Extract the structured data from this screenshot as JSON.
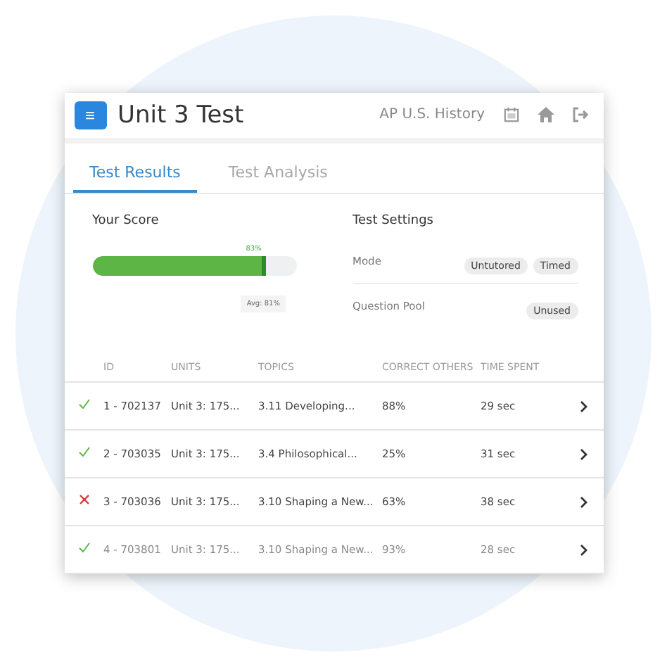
{
  "header": {
    "menu_icon": "≡",
    "title": "Unit 3 Test",
    "course": "AP U.S. History"
  },
  "tabs": [
    {
      "label": "Test Results",
      "selected": true
    },
    {
      "label": "Test Analysis",
      "selected": false
    }
  ],
  "score": {
    "title": "Your Score",
    "level": 0.83,
    "value_label": "83%",
    "average_label": "Avg: 81%"
  },
  "settings": {
    "title": "Test Settings",
    "rows": [
      {
        "label": "Mode",
        "tags": [
          "Untutored",
          "Timed"
        ]
      },
      {
        "label": "Question Pool",
        "tags": [
          "Unused"
        ]
      }
    ]
  },
  "table": {
    "columns": [
      "ID",
      "UNITS",
      "TOPICS",
      "CORRECT OTHERS",
      "TIME SPENT"
    ],
    "rows": [
      {
        "correct": true,
        "faded": false,
        "cells": [
          "1 - 702137",
          "Unit 3: 175...",
          "3.11 Developing...",
          "88%",
          "29 sec"
        ]
      },
      {
        "correct": true,
        "faded": false,
        "cells": [
          "2 - 703035",
          "Unit 3: 175...",
          "3.4 Philosophical...",
          "25%",
          "31 sec"
        ]
      },
      {
        "correct": false,
        "faded": false,
        "cells": [
          "3 - 703036",
          "Unit 3: 175...",
          "3.10 Shaping a New...",
          "63%",
          "38 sec"
        ]
      },
      {
        "correct": true,
        "faded": true,
        "cells": [
          "4 - 703801",
          "Unit 3: 175...",
          "3.10 Shaping a New...",
          "93%",
          "28 sec"
        ]
      }
    ]
  }
}
